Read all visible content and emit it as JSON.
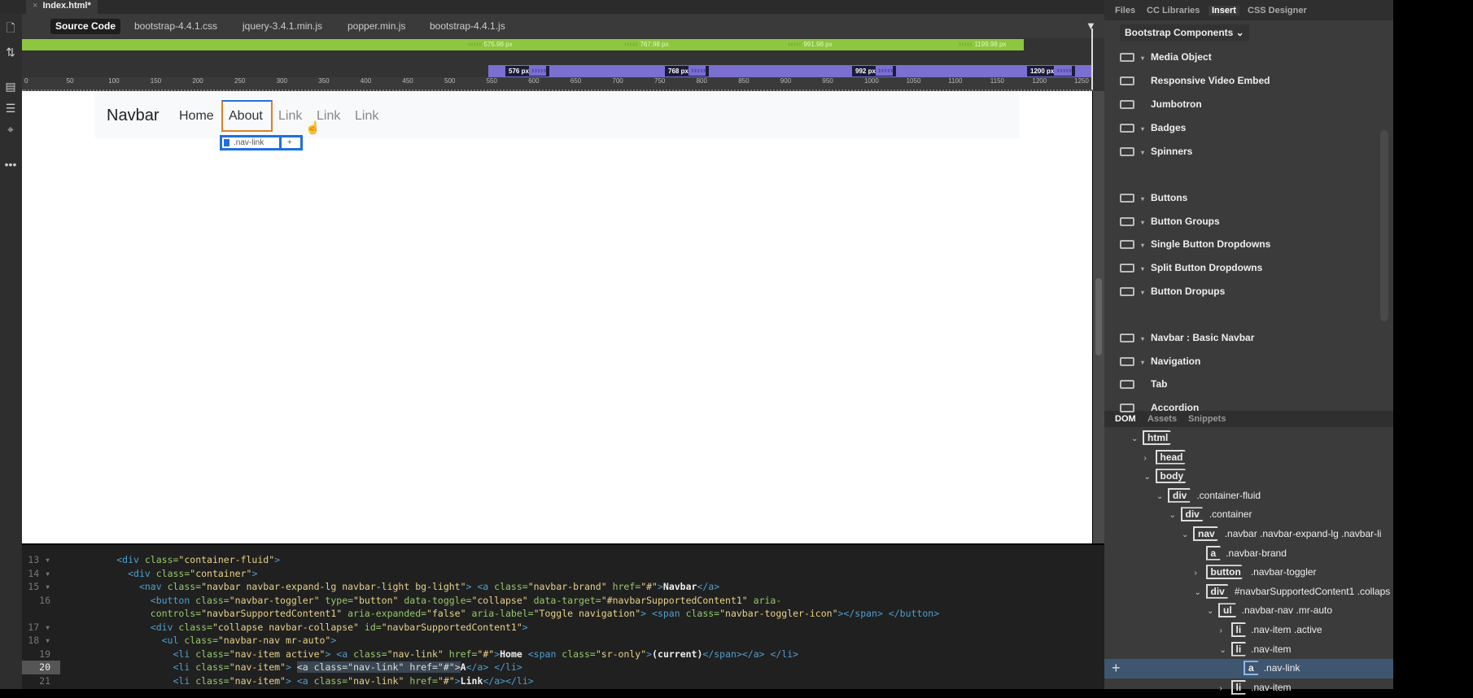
{
  "document_tab": {
    "close": "×",
    "title": "Index.html*"
  },
  "source_tabs": [
    "Source Code",
    "bootstrap-4.4.1.css",
    "jquery-3.4.1.min.js",
    "popper.min.js",
    "bootstrap-4.4.1.js"
  ],
  "media_queries": {
    "min_width": [
      "575.98 px",
      "767.98 px",
      "991.98 px",
      "1199.98 px"
    ],
    "max_width": [
      "576 px",
      "768 px",
      "992 px",
      "1200 px"
    ]
  },
  "ruler_ticks": [
    "0",
    "50",
    "100",
    "150",
    "200",
    "250",
    "300",
    "350",
    "400",
    "450",
    "500",
    "550",
    "600",
    "650",
    "700",
    "750",
    "800",
    "850",
    "900",
    "950",
    "1000",
    "1050",
    "1100",
    "1150",
    "1200",
    "1250"
  ],
  "design": {
    "brand": "Navbar",
    "links": [
      "Home",
      "About",
      "Link",
      "Link",
      "Link"
    ],
    "selected_tag": {
      "tag": "a",
      "class": ".nav-link",
      "add": "+"
    }
  },
  "code": [
    {
      "n": "13 ▾",
      "indent": 4,
      "segs": [
        [
          "tag",
          "<div "
        ],
        [
          "attr",
          "class="
        ],
        [
          "str",
          "\"container-fluid\""
        ],
        [
          "tag",
          ">"
        ]
      ]
    },
    {
      "n": "14 ▾",
      "indent": 6,
      "segs": [
        [
          "tag",
          "<div "
        ],
        [
          "attr",
          "class="
        ],
        [
          "str",
          "\"container\""
        ],
        [
          "tag",
          ">"
        ]
      ]
    },
    {
      "n": "15 ▾",
      "indent": 8,
      "segs": [
        [
          "tag",
          "<nav "
        ],
        [
          "attr",
          "class="
        ],
        [
          "str",
          "\"navbar navbar-expand-lg navbar-light bg-light\""
        ],
        [
          "tag",
          "> <a "
        ],
        [
          "attr",
          "class="
        ],
        [
          "str",
          "\"navbar-brand\" "
        ],
        [
          "attr",
          "href="
        ],
        [
          "str",
          "\"#\""
        ],
        [
          "tag",
          ">"
        ],
        [
          "txt",
          "Navbar"
        ],
        [
          "tag",
          "</a>"
        ]
      ]
    },
    {
      "n": "16",
      "indent": 10,
      "segs": [
        [
          "tag",
          "<button "
        ],
        [
          "attr",
          "class="
        ],
        [
          "str",
          "\"navbar-toggler\" "
        ],
        [
          "attr",
          "type="
        ],
        [
          "str",
          "\"button\" "
        ],
        [
          "attr",
          "data-toggle="
        ],
        [
          "str",
          "\"collapse\" "
        ],
        [
          "attr",
          "data-target="
        ],
        [
          "str",
          "\"#navbarSupportedContent1\" "
        ],
        [
          "attr",
          "aria-"
        ]
      ]
    },
    {
      "n": "",
      "indent": 10,
      "segs": [
        [
          "attr",
          "controls="
        ],
        [
          "str",
          "\"navbarSupportedContent1\" "
        ],
        [
          "attr",
          "aria-expanded="
        ],
        [
          "str",
          "\"false\" "
        ],
        [
          "attr",
          "aria-label="
        ],
        [
          "str",
          "\"Toggle navigation\""
        ],
        [
          "tag",
          "> <span "
        ],
        [
          "attr",
          "class="
        ],
        [
          "str",
          "\"navbar-toggler-icon\""
        ],
        [
          "tag",
          "></span> </button>"
        ]
      ]
    },
    {
      "n": "17 ▾",
      "indent": 10,
      "segs": [
        [
          "tag",
          "<div "
        ],
        [
          "attr",
          "class="
        ],
        [
          "str",
          "\"collapse navbar-collapse\" "
        ],
        [
          "attr",
          "id="
        ],
        [
          "str",
          "\"navbarSupportedContent1\""
        ],
        [
          "tag",
          ">"
        ]
      ]
    },
    {
      "n": "18 ▾",
      "indent": 12,
      "segs": [
        [
          "tag",
          "<ul "
        ],
        [
          "attr",
          "class="
        ],
        [
          "str",
          "\"navbar-nav mr-auto\""
        ],
        [
          "tag",
          ">"
        ]
      ]
    },
    {
      "n": "19",
      "indent": 14,
      "segs": [
        [
          "tag",
          "<li "
        ],
        [
          "attr",
          "class="
        ],
        [
          "str",
          "\"nav-item active\""
        ],
        [
          "tag",
          "> <a "
        ],
        [
          "attr",
          "class="
        ],
        [
          "str",
          "\"nav-link\" "
        ],
        [
          "attr",
          "href="
        ],
        [
          "str",
          "\"#\""
        ],
        [
          "tag",
          ">"
        ],
        [
          "txt",
          "Home "
        ],
        [
          "tag",
          "<span "
        ],
        [
          "attr",
          "class="
        ],
        [
          "str",
          "\"sr-only\""
        ],
        [
          "tag",
          ">"
        ],
        [
          "txt",
          "(current)"
        ],
        [
          "tag",
          "</span></a> </li>"
        ]
      ]
    },
    {
      "n": "20",
      "indent": 14,
      "cur": true,
      "segs": [
        [
          "tag",
          "<li "
        ],
        [
          "attr",
          "class="
        ],
        [
          "str",
          "\"nav-item\""
        ],
        [
          "tag",
          "> "
        ],
        [
          "sel",
          "<a class=\"nav-link\" href=\"#\">"
        ],
        [
          "txt",
          "A"
        ],
        [
          "tag",
          "</a> </li>"
        ]
      ]
    },
    {
      "n": "21",
      "indent": 14,
      "segs": [
        [
          "tag",
          "<li "
        ],
        [
          "attr",
          "class="
        ],
        [
          "str",
          "\"nav-item\""
        ],
        [
          "tag",
          "> <a "
        ],
        [
          "attr",
          "class="
        ],
        [
          "str",
          "\"nav-link\" "
        ],
        [
          "attr",
          "href="
        ],
        [
          "str",
          "\"#\""
        ],
        [
          "tag",
          ">"
        ],
        [
          "txt",
          "Link"
        ],
        [
          "tag",
          "</a></li>"
        ]
      ]
    }
  ],
  "panel": {
    "tabs": [
      "Files",
      "CC Libraries",
      "Insert",
      "CSS Designer"
    ],
    "active_tab": "Insert",
    "category": "Bootstrap Components",
    "items": [
      {
        "label": "Media Object",
        "arrow": true
      },
      {
        "label": "Responsive Video Embed",
        "arrow": false
      },
      {
        "label": "Jumbotron",
        "arrow": false
      },
      {
        "label": "Badges",
        "arrow": true
      },
      {
        "label": "Spinners",
        "arrow": true
      },
      {
        "label": "Buttons",
        "arrow": true
      },
      {
        "label": "Button Groups",
        "arrow": true
      },
      {
        "label": "Single Button Dropdowns",
        "arrow": true
      },
      {
        "label": "Split Button Dropdowns",
        "arrow": true
      },
      {
        "label": "Button Dropups",
        "arrow": true
      },
      {
        "label": "Navbar : Basic Navbar",
        "arrow": true
      },
      {
        "label": "Navigation",
        "arrow": true
      },
      {
        "label": "Tab",
        "arrow": false
      },
      {
        "label": "Accordion",
        "arrow": false
      }
    ]
  },
  "dom_panel": {
    "tabs": [
      "DOM",
      "Assets",
      "Snippets"
    ],
    "add": "+",
    "tree": [
      {
        "depth": 0,
        "chev": "⌄",
        "tag": "html",
        "cls": ""
      },
      {
        "depth": 1,
        "chev": "›",
        "tag": "head",
        "cls": ""
      },
      {
        "depth": 1,
        "chev": "⌄",
        "tag": "body",
        "cls": ""
      },
      {
        "depth": 2,
        "chev": "⌄",
        "tag": "div",
        "cls": ".container-fluid"
      },
      {
        "depth": 3,
        "chev": "⌄",
        "tag": "div",
        "cls": ".container"
      },
      {
        "depth": 4,
        "chev": "⌄",
        "tag": "nav",
        "cls": ".navbar .navbar-expand-lg .navbar-li"
      },
      {
        "depth": 5,
        "chev": "",
        "tag": "a",
        "cls": ".navbar-brand"
      },
      {
        "depth": 5,
        "chev": "›",
        "tag": "button",
        "cls": ".navbar-toggler"
      },
      {
        "depth": 5,
        "chev": "⌄",
        "tag": "div",
        "cls": "#navbarSupportedContent1 .collaps"
      },
      {
        "depth": 6,
        "chev": "⌄",
        "tag": "ul",
        "cls": ".navbar-nav .mr-auto"
      },
      {
        "depth": 7,
        "chev": "›",
        "tag": "li",
        "cls": ".nav-item .active"
      },
      {
        "depth": 7,
        "chev": "⌄",
        "tag": "li",
        "cls": ".nav-item"
      },
      {
        "depth": 8,
        "chev": "",
        "tag": "a",
        "cls": ".nav-link",
        "selected": true
      },
      {
        "depth": 7,
        "chev": "›",
        "tag": "li",
        "cls": ".nav-item"
      }
    ]
  }
}
